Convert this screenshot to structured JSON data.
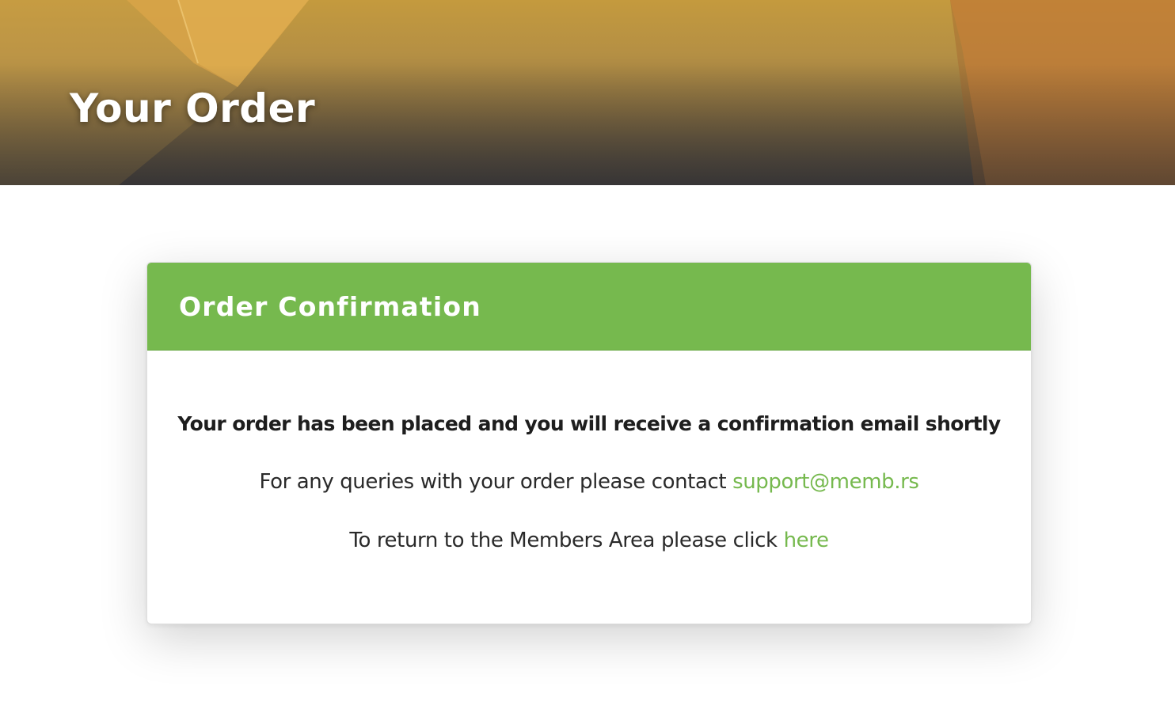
{
  "hero": {
    "title": "Your Order"
  },
  "card": {
    "title": "Order Confirmation",
    "message_main": "Your order has been placed and you will receive a confirmation email shortly",
    "support_prefix": "For any queries with your order please contact ",
    "support_email": "support@memb.rs",
    "return_prefix": "To return to the Members Area please click ",
    "return_link": "here"
  },
  "colors": {
    "accent_green": "#76b94e",
    "hero_gold": "#c49a3e",
    "hero_dark": "#4a4540"
  }
}
